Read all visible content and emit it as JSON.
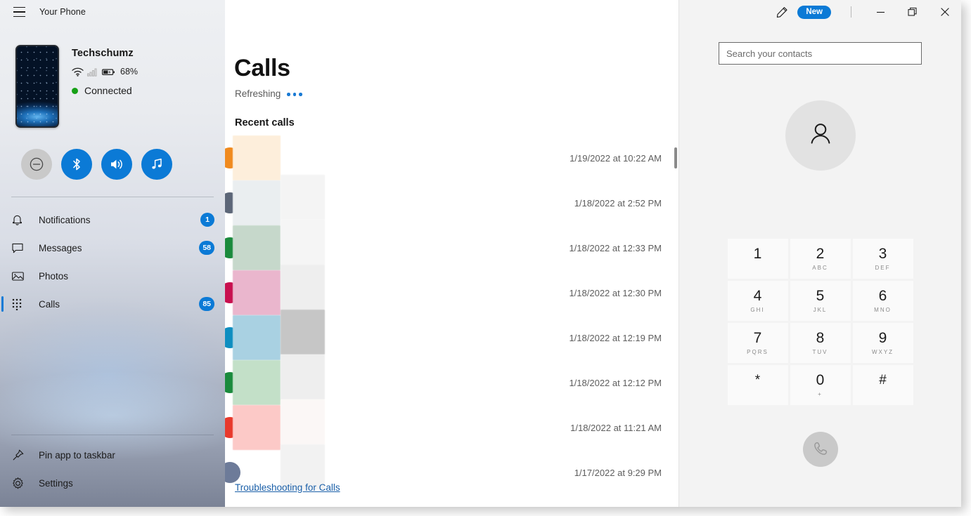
{
  "app": {
    "title": "Your Phone",
    "menu_icon": "hamburger-icon"
  },
  "device": {
    "name": "Techschumz",
    "battery_percent": "68%",
    "status_text": "Connected",
    "status_color": "#16a016",
    "wifi_icon": "wifi-icon",
    "signal_icon": "cellular-signal-icon",
    "battery_icon": "battery-charging-icon"
  },
  "quick_actions": [
    {
      "name": "do-not-disturb",
      "icon": "do-not-disturb-icon",
      "enabled": false
    },
    {
      "name": "bluetooth",
      "icon": "bluetooth-icon",
      "enabled": true
    },
    {
      "name": "volume",
      "icon": "speaker-volume-icon",
      "enabled": true
    },
    {
      "name": "music",
      "icon": "music-note-icon",
      "enabled": true
    }
  ],
  "sidebar": {
    "items": [
      {
        "label": "Notifications",
        "icon": "bell-icon",
        "badge": "1",
        "selected": false
      },
      {
        "label": "Messages",
        "icon": "chat-bubble-icon",
        "badge": "58",
        "selected": false
      },
      {
        "label": "Photos",
        "icon": "photo-icon",
        "badge": "",
        "selected": false
      },
      {
        "label": "Calls",
        "icon": "dialpad-icon",
        "badge": "85",
        "selected": true
      }
    ],
    "bottom_items": [
      {
        "label": "Pin app to taskbar",
        "icon": "pin-icon"
      },
      {
        "label": "Settings",
        "icon": "gear-icon"
      }
    ],
    "badge_color": "#0b7ad6",
    "accent_color": "#0b7ad6"
  },
  "main": {
    "page_title": "Calls",
    "refreshing_label": "Refreshing",
    "section_title": "Recent calls",
    "troubleshoot_link": "Troubleshooting for Calls",
    "recent_calls": [
      {
        "time": "1/19/2022 at 10:22 AM",
        "avatar_color": "#f08a1e",
        "redact_color": "#fdeedb",
        "redact_width": 68,
        "redact2_color": "",
        "redact2_width": 0
      },
      {
        "time": "1/18/2022 at 2:52 PM",
        "avatar_color": "#5c6678",
        "redact_color": "#eaeef0",
        "redact_width": 68,
        "redact2_color": "#f4f4f4",
        "redact2_width": 63
      },
      {
        "time": "1/18/2022 at 12:33 PM",
        "avatar_color": "#1a8a3c",
        "redact_color": "#c6d8cb",
        "redact_width": 68,
        "redact2_color": "#f5f5f5",
        "redact2_width": 63
      },
      {
        "time": "1/18/2022 at 12:30 PM",
        "avatar_color": "#c8104f",
        "redact_color": "#eab6cd",
        "redact_width": 68,
        "redact2_color": "#eeeeee",
        "redact2_width": 63
      },
      {
        "time": "1/18/2022 at 12:19 PM",
        "avatar_color": "#0e8ec0",
        "redact_color": "#a9d1e2",
        "redact_width": 68,
        "redact2_color": "#c6c6c6",
        "redact2_width": 63
      },
      {
        "time": "1/18/2022 at 12:12 PM",
        "avatar_color": "#1a8a3c",
        "redact_color": "#c3e0c8",
        "redact_width": 68,
        "redact2_color": "#eeeeee",
        "redact2_width": 63
      },
      {
        "time": "1/18/2022 at 11:21 AM",
        "avatar_color": "#e8392c",
        "redact_color": "#fcc9c7",
        "redact_width": 68,
        "redact2_color": "#fbf7f6",
        "redact2_width": 63
      },
      {
        "time": "1/17/2022 at 9:29 PM",
        "avatar_color": "#6d7b99",
        "redact_color": "",
        "redact_width": 0,
        "redact2_color": "#f2f2f2",
        "redact2_width": 63
      }
    ]
  },
  "titlebar": {
    "pencil_icon": "pencil-edit-icon",
    "new_badge": "New",
    "minimize_icon": "minimize-icon",
    "restore_icon": "restore-window-icon",
    "close_icon": "close-icon"
  },
  "right_panel": {
    "search_placeholder": "Search your contacts",
    "search_value": "",
    "avatar_icon": "person-icon",
    "call_button_icon": "phone-handset-icon",
    "dialpad": [
      {
        "num": "1",
        "sub": ""
      },
      {
        "num": "2",
        "sub": "ABC"
      },
      {
        "num": "3",
        "sub": "DEF"
      },
      {
        "num": "4",
        "sub": "GHI"
      },
      {
        "num": "5",
        "sub": "JKL"
      },
      {
        "num": "6",
        "sub": "MNO"
      },
      {
        "num": "7",
        "sub": "PQRS"
      },
      {
        "num": "8",
        "sub": "TUV"
      },
      {
        "num": "9",
        "sub": "WXYZ"
      },
      {
        "num": "*",
        "sub": ""
      },
      {
        "num": "0",
        "sub": "+"
      },
      {
        "num": "#",
        "sub": ""
      }
    ]
  }
}
